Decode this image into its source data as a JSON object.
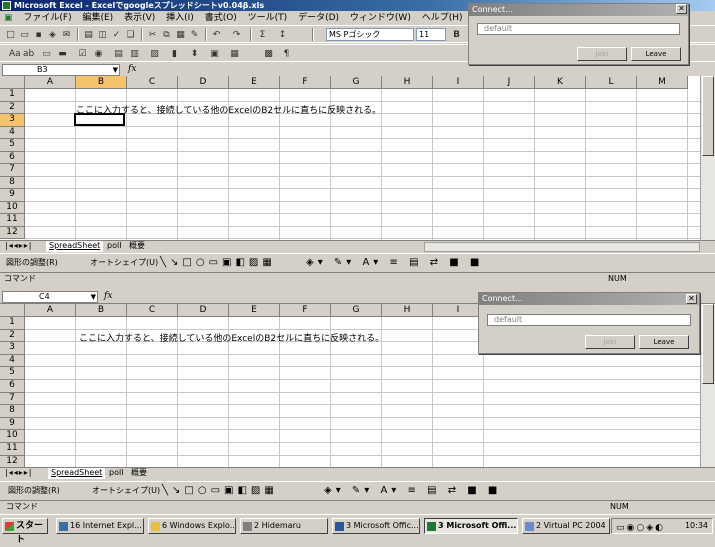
{
  "window_title": "Microsoft Excel - Excelでgoogleスプレッドシートv0.04β.xls",
  "menu": [
    "ファイル(F)",
    "編集(E)",
    "表示(V)",
    "挿入(I)",
    "書式(O)",
    "ツール(T)",
    "データ(D)",
    "ウィンドウ(W)",
    "ヘルプ(H)"
  ],
  "font_name": "MS Pゴシック",
  "font_size": "11",
  "bold_label": "B",
  "fx_label": "fx",
  "top": {
    "namebox": "B3",
    "columns": [
      "A",
      "B",
      "C",
      "D",
      "E",
      "F",
      "G",
      "H",
      "I",
      "J",
      "K",
      "L",
      "M"
    ],
    "rows": [
      "1",
      "2",
      "3",
      "4",
      "5",
      "6",
      "7",
      "8",
      "9",
      "10",
      "11",
      "12"
    ],
    "cell_b2": "ここに入力すると、接続している他のExcelのB2セルに直ちに反映される。"
  },
  "bottom": {
    "namebox": "C4",
    "columns": [
      "A",
      "B",
      "C",
      "D",
      "E",
      "F",
      "G",
      "H",
      "I"
    ],
    "rows": [
      "1",
      "2",
      "3",
      "4",
      "5",
      "6",
      "7",
      "8",
      "9",
      "10",
      "11",
      "12"
    ],
    "cell_b2": "ここに入力すると、接続している他のExcelのB2セルに直ちに反映される。"
  },
  "sheet_tabs": [
    "SpreadSheet",
    "poll",
    "概要"
  ],
  "draw_menu": "図形の調整(R)",
  "autoshape": "オートシェイプ(U)",
  "status_left": "コマンド",
  "status_num": "NUM",
  "connect_dialog": {
    "title": "Connect...",
    "input_value": "default",
    "join_label": "Join",
    "leave_label": "Leave"
  },
  "taskbar": {
    "start": "スタート",
    "items": [
      "16 Internet Expl...",
      "6 Windows Explo...",
      "2 Hidemaru",
      "3 Microsoft Offic...",
      "3 Microsoft Offi...",
      "2 Virtual PC 2004"
    ],
    "active_index": 4,
    "clock": "10:34"
  }
}
